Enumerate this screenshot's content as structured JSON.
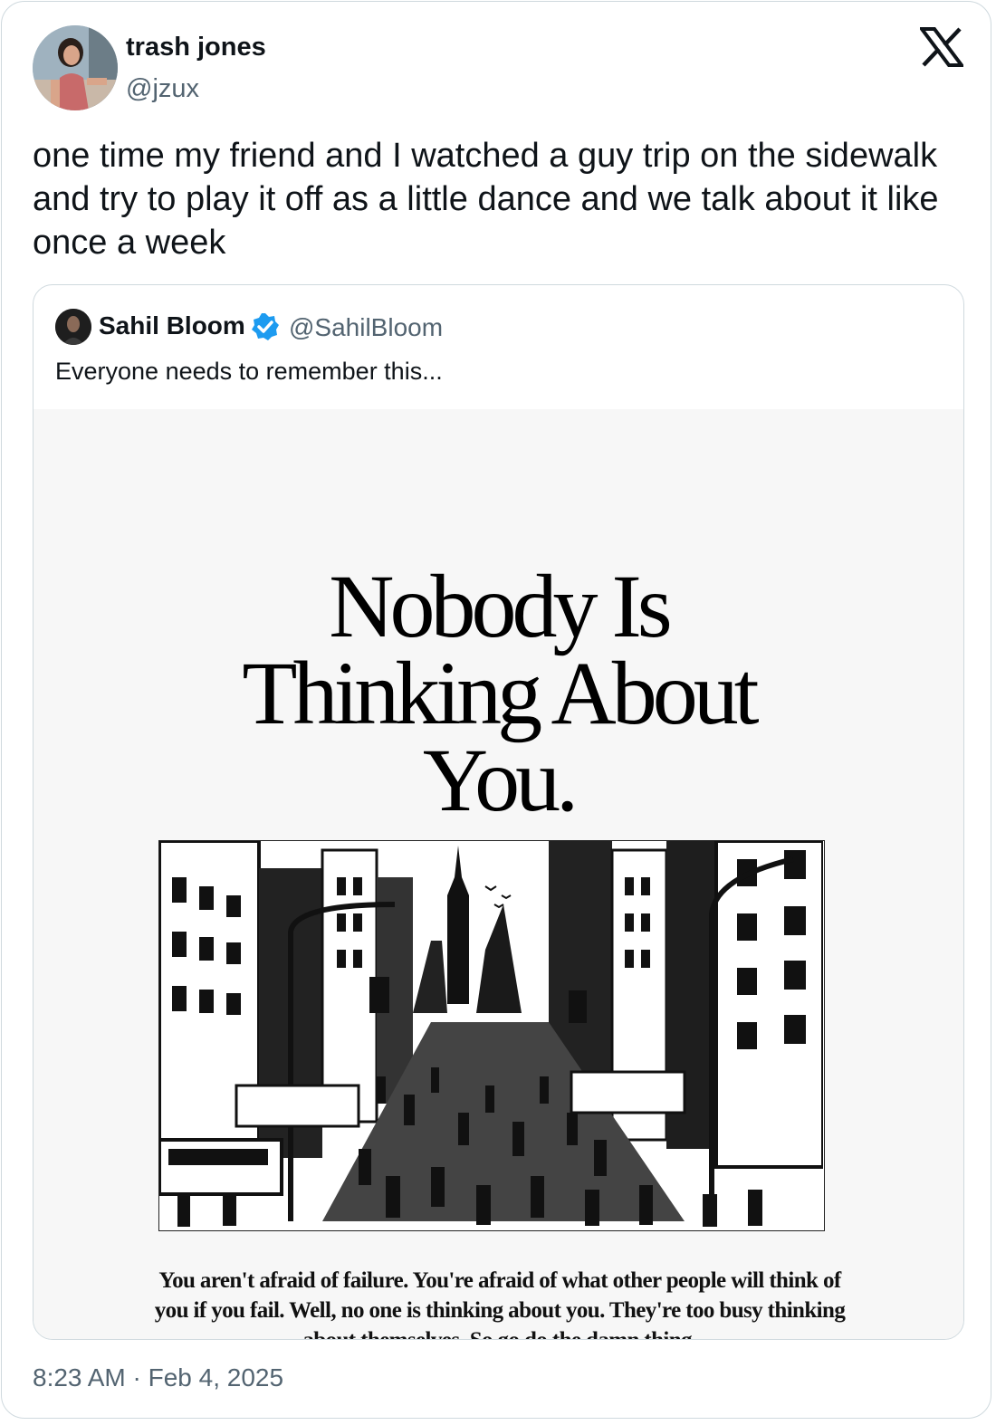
{
  "author": {
    "name": "trash jones",
    "handle": "@jzux"
  },
  "brand_icon": "x-logo-icon",
  "tweet": {
    "text": "one time my friend and I watched a guy trip on the sidewalk and try to play it off as a little dance and we talk about it like once a week"
  },
  "quoted": {
    "name": "Sahil Bloom",
    "verified": true,
    "verified_color": "#1d9bf0",
    "handle": "@SahilBloom",
    "text": "Everyone needs to remember this...",
    "media": {
      "headline_lines": [
        "Nobody Is",
        "Thinking About",
        "You."
      ],
      "illustration": "city-crowd-illustration",
      "caption": "You aren't afraid of failure. You're afraid of what other people will think of you if you fail. Well, no one is thinking about you. They're too busy thinking about themselves. So go do the damn thing."
    }
  },
  "footer": {
    "timestamp": "8:23 AM · Feb 4, 2025"
  }
}
